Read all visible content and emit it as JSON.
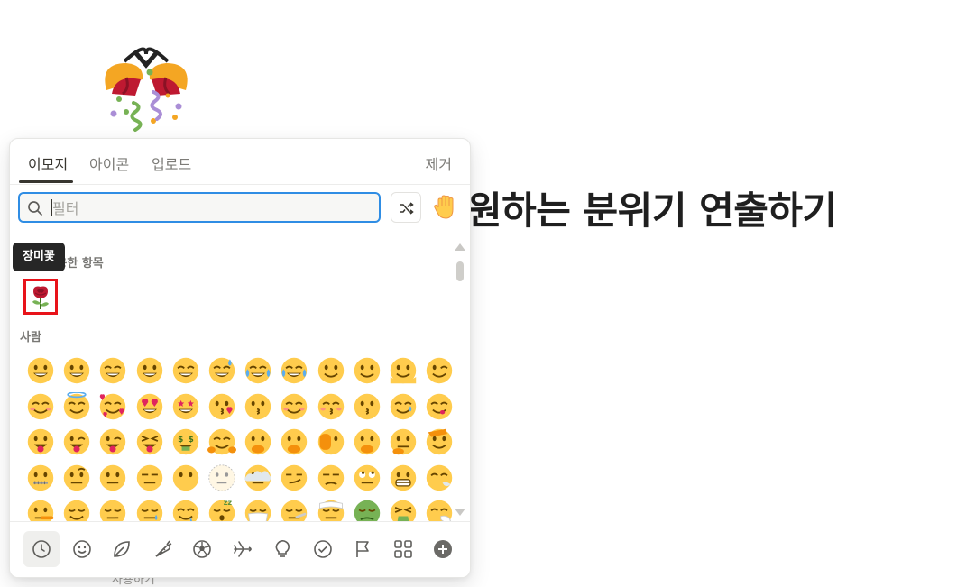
{
  "page": {
    "title": "원하는 분위기 연출하기",
    "subtext": "사용하기",
    "icon": "party-popper-icon"
  },
  "picker": {
    "tabs": [
      {
        "label": "이모지",
        "active": true
      },
      {
        "label": "아이콘",
        "active": false
      },
      {
        "label": "업로드",
        "active": false
      }
    ],
    "remove_label": "제거",
    "search": {
      "placeholder": "필터",
      "value": ""
    },
    "shuffle_icon": "shuffle-icon",
    "skin_tone_icon": "raised-hand-icon",
    "tooltip": "장미꽃",
    "recent_label": "최근 사용한 항목",
    "recent_items": [
      "rose"
    ],
    "people_label": "사람",
    "people_emojis": [
      "grinning",
      "smiley",
      "smile",
      "grin",
      "laughing",
      "sweat-smile",
      "rofl",
      "joy",
      "slight-smile",
      "upside-down",
      "melting",
      "wink",
      "blush",
      "innocent",
      "smiling-hearts",
      "heart-eyes",
      "star-struck",
      "kissing-heart",
      "kissing",
      "relaxed",
      "kissing-closed-eyes",
      "kissing-smiling-eyes",
      "smiling-tear",
      "yum",
      "tongue",
      "tongue-wink",
      "zany",
      "tongue-closed-eyes",
      "money-mouth",
      "hugging",
      "hand-over-mouth",
      "open-eyes-hand",
      "peeking",
      "shushing",
      "thinking",
      "saluting",
      "zipper",
      "raised-eyebrow",
      "neutral",
      "expressionless",
      "no-mouth",
      "dotted-line",
      "in-clouds",
      "smirk",
      "unamused",
      "rolling-eyes",
      "grimacing",
      "exhaling",
      "lying",
      "relieved",
      "pensive",
      "sleepy",
      "drooling",
      "sleeping",
      "mask",
      "thermometer",
      "bandage",
      "nauseated",
      "vomiting",
      "sneezing"
    ],
    "categories": [
      {
        "name": "recent",
        "icon": "clock-icon",
        "active": true
      },
      {
        "name": "people",
        "icon": "smiley-icon",
        "active": false
      },
      {
        "name": "nature",
        "icon": "leaf-icon",
        "active": false
      },
      {
        "name": "food",
        "icon": "carrot-icon",
        "active": false
      },
      {
        "name": "activity",
        "icon": "soccer-ball-icon",
        "active": false
      },
      {
        "name": "travel",
        "icon": "airplane-icon",
        "active": false
      },
      {
        "name": "objects",
        "icon": "lightbulb-icon",
        "active": false
      },
      {
        "name": "symbols",
        "icon": "check-circle-icon",
        "active": false
      },
      {
        "name": "flags",
        "icon": "flag-icon",
        "active": false
      },
      {
        "name": "custom",
        "icon": "grid-icon",
        "active": false
      },
      {
        "name": "add",
        "icon": "plus-circle-icon",
        "active": false
      }
    ],
    "colors": {
      "accent": "#2f8de4",
      "highlight": "#e8131a",
      "emoji_face": "#ffcc4d"
    }
  }
}
